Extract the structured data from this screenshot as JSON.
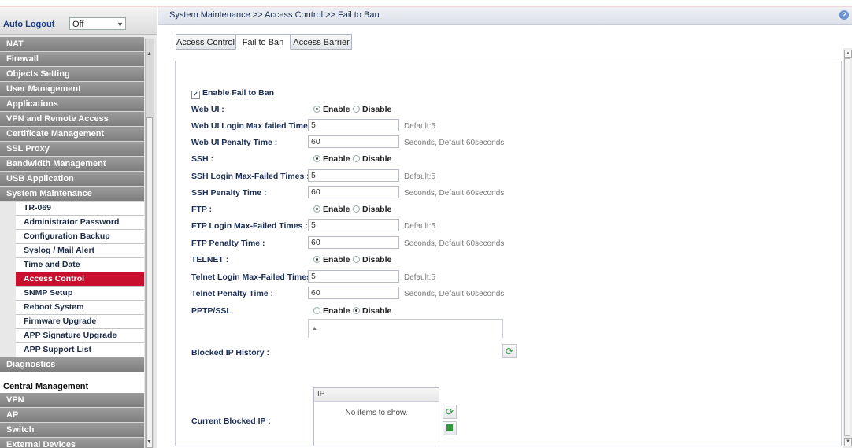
{
  "sidebar": {
    "auto_logout_label": "Auto Logout",
    "auto_logout_value": "Off",
    "menu": [
      {
        "label": "NAT",
        "kind": "header"
      },
      {
        "label": "Firewall",
        "kind": "header"
      },
      {
        "label": "Objects Setting",
        "kind": "header"
      },
      {
        "label": "User Management",
        "kind": "header"
      },
      {
        "label": "Applications",
        "kind": "header"
      },
      {
        "label": "VPN and Remote Access",
        "kind": "header"
      },
      {
        "label": "Certificate Management",
        "kind": "header"
      },
      {
        "label": "SSL Proxy",
        "kind": "header"
      },
      {
        "label": "Bandwidth Management",
        "kind": "header"
      },
      {
        "label": "USB Application",
        "kind": "header"
      },
      {
        "label": "System Maintenance",
        "kind": "header"
      },
      {
        "label": "TR-069",
        "kind": "sub"
      },
      {
        "label": "Administrator Password",
        "kind": "sub"
      },
      {
        "label": "Configuration Backup",
        "kind": "sub"
      },
      {
        "label": "Syslog / Mail Alert",
        "kind": "sub"
      },
      {
        "label": "Time and Date",
        "kind": "sub"
      },
      {
        "label": "Access Control",
        "kind": "sub",
        "active": true
      },
      {
        "label": "SNMP Setup",
        "kind": "sub"
      },
      {
        "label": "Reboot System",
        "kind": "sub"
      },
      {
        "label": "Firmware Upgrade",
        "kind": "sub"
      },
      {
        "label": "APP Signature Upgrade",
        "kind": "sub"
      },
      {
        "label": "APP Support List",
        "kind": "sub"
      },
      {
        "label": "Diagnostics",
        "kind": "header"
      },
      {
        "label": "",
        "kind": "gap"
      },
      {
        "label": "Central Management",
        "kind": "section"
      },
      {
        "label": "VPN",
        "kind": "header"
      },
      {
        "label": "AP",
        "kind": "header"
      },
      {
        "label": "Switch",
        "kind": "header"
      },
      {
        "label": "External Devices",
        "kind": "header"
      }
    ]
  },
  "header": {
    "breadcrumb": "System Maintenance >> Access Control >> Fail to Ban",
    "help_icon": "?"
  },
  "tabs": [
    {
      "label": "Access Control",
      "active": false
    },
    {
      "label": "Fail to Ban",
      "active": true
    },
    {
      "label": "Access Barrier",
      "active": false
    }
  ],
  "form": {
    "enable_fail_to_ban": {
      "label": "Enable Fail to Ban",
      "checked": true
    },
    "enable_label": "Enable",
    "disable_label": "Disable",
    "webui": {
      "label": "Web UI :",
      "enabled": true,
      "max_label": "Web UI Login Max failed Times :",
      "max_value": "5",
      "max_hint": "Default:5",
      "penalty_label": "Web UI Penalty Time :",
      "penalty_value": "60",
      "penalty_hint": "Seconds, Default:60seconds"
    },
    "ssh": {
      "label": "SSH :",
      "enabled": true,
      "max_label": "SSH Login Max-Failed Times :",
      "max_value": "5",
      "max_hint": "Default:5",
      "penalty_label": "SSH Penalty Time :",
      "penalty_value": "60",
      "penalty_hint": "Seconds, Default:60seconds"
    },
    "ftp": {
      "label": "FTP :",
      "enabled": true,
      "max_label": "FTP Login Max-Failed Times :",
      "max_value": "5",
      "max_hint": "Default:5",
      "penalty_label": "FTP Penalty Time :",
      "penalty_value": "60",
      "penalty_hint": "Seconds, Default:60seconds"
    },
    "telnet": {
      "label": "TELNET :",
      "enabled": true,
      "max_label": "Telnet Login Max-Failed Times :",
      "max_value": "5",
      "max_hint": "Default:5",
      "penalty_label": "Telnet Penalty Time :",
      "penalty_value": "60",
      "penalty_hint": "Seconds, Default:60seconds"
    },
    "pptp": {
      "label": "PPTP/SSL",
      "enabled": false
    },
    "blocked_history_label": "Blocked IP History :",
    "current_blocked_label": "Current Blocked IP :",
    "grid_header": "IP",
    "grid_empty": "No items to show."
  }
}
